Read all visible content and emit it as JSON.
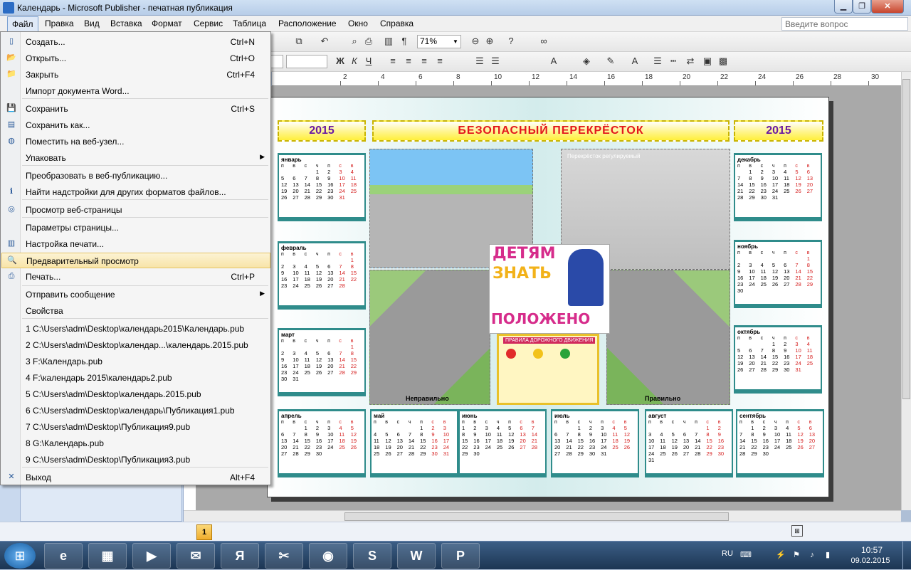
{
  "window": {
    "title": "Календарь - Microsoft Publisher - печатная публикация"
  },
  "menubar": {
    "items": [
      "Файл",
      "Правка",
      "Вид",
      "Вставка",
      "Формат",
      "Сервис",
      "Таблица",
      "Расположение",
      "Окно",
      "Справка"
    ],
    "ask_placeholder": "Введите вопрос"
  },
  "toolbar": {
    "zoom": "71%"
  },
  "ruler": {
    "marks": [
      "2",
      "4",
      "6",
      "8",
      "10",
      "12",
      "14",
      "16",
      "18",
      "20",
      "22",
      "24",
      "26",
      "28",
      "30"
    ]
  },
  "file_menu": {
    "items": [
      {
        "label": "Создать...",
        "shortcut": "Ctrl+N",
        "icon": "new-doc-icon"
      },
      {
        "label": "Открыть...",
        "shortcut": "Ctrl+O",
        "icon": "open-folder-icon"
      },
      {
        "label": "Закрыть",
        "shortcut": "Ctrl+F4",
        "icon": "close-folder-icon"
      },
      {
        "label": "Импорт документа Word...",
        "shortcut": "",
        "icon": ""
      },
      {
        "label": "Сохранить",
        "shortcut": "Ctrl+S",
        "icon": "save-icon"
      },
      {
        "label": "Сохранить как...",
        "shortcut": "",
        "icon": "save-as-icon"
      },
      {
        "label": "Поместить на веб-узел...",
        "shortcut": "",
        "icon": "web-publish-icon"
      },
      {
        "label": "Упаковать",
        "shortcut": "",
        "icon": ""
      },
      {
        "label": "Преобразовать в веб-публикацию...",
        "shortcut": "",
        "icon": ""
      },
      {
        "label": "Найти надстройки для других форматов файлов...",
        "shortcut": "",
        "icon": "info-icon"
      },
      {
        "label": "Просмотр веб-страницы",
        "shortcut": "",
        "icon": "web-preview-icon"
      },
      {
        "label": "Параметры страницы...",
        "shortcut": "",
        "icon": ""
      },
      {
        "label": "Настройка печати...",
        "shortcut": "",
        "icon": "print-setup-icon"
      },
      {
        "label": "Предварительный просмотр",
        "shortcut": "",
        "icon": "print-preview-icon"
      },
      {
        "label": "Печать...",
        "shortcut": "Ctrl+P",
        "icon": "printer-icon"
      },
      {
        "label": "Отправить сообщение",
        "shortcut": "",
        "icon": ""
      },
      {
        "label": "Свойства",
        "shortcut": "",
        "icon": ""
      },
      {
        "label": "1 C:\\Users\\adm\\Desktop\\календарь2015\\Календарь.pub",
        "shortcut": "",
        "icon": ""
      },
      {
        "label": "2 C:\\Users\\adm\\Desktop\\календар...\\календарь.2015.pub",
        "shortcut": "",
        "icon": ""
      },
      {
        "label": "3 F:\\Календарь.pub",
        "shortcut": "",
        "icon": ""
      },
      {
        "label": "4 F:\\календарь 2015\\календарь2.pub",
        "shortcut": "",
        "icon": ""
      },
      {
        "label": "5 C:\\Users\\adm\\Desktop\\календарь.2015.pub",
        "shortcut": "",
        "icon": ""
      },
      {
        "label": "6 C:\\Users\\adm\\Desktop\\календарь\\Публикация1.pub",
        "shortcut": "",
        "icon": ""
      },
      {
        "label": "7 C:\\Users\\adm\\Desktop\\Публикация9.pub",
        "shortcut": "",
        "icon": ""
      },
      {
        "label": "8 G:\\Календарь.pub",
        "shortcut": "",
        "icon": ""
      },
      {
        "label": "9 C:\\Users\\adm\\Desktop\\Публикация3.pub",
        "shortcut": "",
        "icon": ""
      },
      {
        "label": "Выход",
        "shortcut": "Alt+F4",
        "icon": "exit-icon"
      }
    ]
  },
  "calendar": {
    "year": "2015",
    "headline": "БЕЗОПАСНЫЙ ПЕРЕКРЁСТОК",
    "weekdays": [
      "п",
      "в",
      "с",
      "ч",
      "п",
      "с",
      "в"
    ],
    "caption_wrong": "Неправильно",
    "caption_right": "Правильно",
    "poster_line1": "ДЕТЯМ",
    "poster_line2": "ЗНАТЬ",
    "poster_line3": "ПОЛОЖЕНО",
    "rules_title": "ПРАВИЛА ДОРОЖНОГО ДВИЖЕНИЯ",
    "photo_caption": "Перекрёсток регулируемый",
    "months": {
      "jan": {
        "name": "январь",
        "days": [
          "",
          "",
          "",
          "1",
          "2",
          "3",
          "4",
          "5",
          "6",
          "7",
          "8",
          "9",
          "10",
          "11",
          "12",
          "13",
          "14",
          "15",
          "16",
          "17",
          "18",
          "19",
          "20",
          "21",
          "22",
          "23",
          "24",
          "25",
          "26",
          "27",
          "28",
          "29",
          "30",
          "31"
        ]
      },
      "feb": {
        "name": "февраль",
        "days": [
          "",
          "",
          "",
          "",
          "",
          "",
          "1",
          "2",
          "3",
          "4",
          "5",
          "6",
          "7",
          "8",
          "9",
          "10",
          "11",
          "12",
          "13",
          "14",
          "15",
          "16",
          "17",
          "18",
          "19",
          "20",
          "21",
          "22",
          "23",
          "24",
          "25",
          "26",
          "27",
          "28"
        ]
      },
      "mar": {
        "name": "март",
        "days": [
          "",
          "",
          "",
          "",
          "",
          "",
          "1",
          "2",
          "3",
          "4",
          "5",
          "6",
          "7",
          "8",
          "9",
          "10",
          "11",
          "12",
          "13",
          "14",
          "15",
          "16",
          "17",
          "18",
          "19",
          "20",
          "21",
          "22",
          "23",
          "24",
          "25",
          "26",
          "27",
          "28",
          "29",
          "30",
          "31"
        ]
      },
      "apr": {
        "name": "апрель",
        "days": [
          "",
          "",
          "1",
          "2",
          "3",
          "4",
          "5",
          "6",
          "7",
          "8",
          "9",
          "10",
          "11",
          "12",
          "13",
          "14",
          "15",
          "16",
          "17",
          "18",
          "19",
          "20",
          "21",
          "22",
          "23",
          "24",
          "25",
          "26",
          "27",
          "28",
          "29",
          "30"
        ]
      },
      "may": {
        "name": "май",
        "days": [
          "",
          "",
          "",
          "",
          "1",
          "2",
          "3",
          "4",
          "5",
          "6",
          "7",
          "8",
          "9",
          "10",
          "11",
          "12",
          "13",
          "14",
          "15",
          "16",
          "17",
          "18",
          "19",
          "20",
          "21",
          "22",
          "23",
          "24",
          "25",
          "26",
          "27",
          "28",
          "29",
          "30",
          "31"
        ]
      },
      "jun": {
        "name": "июнь",
        "days": [
          "1",
          "2",
          "3",
          "4",
          "5",
          "6",
          "7",
          "8",
          "9",
          "10",
          "11",
          "12",
          "13",
          "14",
          "15",
          "16",
          "17",
          "18",
          "19",
          "20",
          "21",
          "22",
          "23",
          "24",
          "25",
          "26",
          "27",
          "28",
          "29",
          "30"
        ]
      },
      "jul": {
        "name": "июль",
        "days": [
          "",
          "",
          "1",
          "2",
          "3",
          "4",
          "5",
          "6",
          "7",
          "8",
          "9",
          "10",
          "11",
          "12",
          "13",
          "14",
          "15",
          "16",
          "17",
          "18",
          "19",
          "20",
          "21",
          "22",
          "23",
          "24",
          "25",
          "26",
          "27",
          "28",
          "29",
          "30",
          "31"
        ]
      },
      "aug": {
        "name": "август",
        "days": [
          "",
          "",
          "",
          "",
          "",
          "1",
          "2",
          "3",
          "4",
          "5",
          "6",
          "7",
          "8",
          "9",
          "10",
          "11",
          "12",
          "13",
          "14",
          "15",
          "16",
          "17",
          "18",
          "19",
          "20",
          "21",
          "22",
          "23",
          "24",
          "25",
          "26",
          "27",
          "28",
          "29",
          "30",
          "31"
        ]
      },
      "sep": {
        "name": "сентябрь",
        "days": [
          "",
          "1",
          "2",
          "3",
          "4",
          "5",
          "6",
          "7",
          "8",
          "9",
          "10",
          "11",
          "12",
          "13",
          "14",
          "15",
          "16",
          "17",
          "18",
          "19",
          "20",
          "21",
          "22",
          "23",
          "24",
          "25",
          "26",
          "27",
          "28",
          "29",
          "30"
        ]
      },
      "oct": {
        "name": "октябрь",
        "days": [
          "",
          "",
          "",
          "1",
          "2",
          "3",
          "4",
          "5",
          "6",
          "7",
          "8",
          "9",
          "10",
          "11",
          "12",
          "13",
          "14",
          "15",
          "16",
          "17",
          "18",
          "19",
          "20",
          "21",
          "22",
          "23",
          "24",
          "25",
          "26",
          "27",
          "28",
          "29",
          "30",
          "31"
        ]
      },
      "nov": {
        "name": "ноябрь",
        "days": [
          "",
          "",
          "",
          "",
          "",
          "",
          "1",
          "2",
          "3",
          "4",
          "5",
          "6",
          "7",
          "8",
          "9",
          "10",
          "11",
          "12",
          "13",
          "14",
          "15",
          "16",
          "17",
          "18",
          "19",
          "20",
          "21",
          "22",
          "23",
          "24",
          "25",
          "26",
          "27",
          "28",
          "29",
          "30"
        ]
      },
      "dec": {
        "name": "декабрь",
        "days": [
          "",
          "1",
          "2",
          "3",
          "4",
          "5",
          "6",
          "7",
          "8",
          "9",
          "10",
          "11",
          "12",
          "13",
          "14",
          "15",
          "16",
          "17",
          "18",
          "19",
          "20",
          "21",
          "22",
          "23",
          "24",
          "25",
          "26",
          "27",
          "28",
          "29",
          "30",
          "31"
        ]
      }
    }
  },
  "status": {
    "page": "1"
  },
  "tray": {
    "lang": "RU",
    "time": "10:57",
    "date": "09.02.2015"
  },
  "taskbar": {
    "apps": [
      "internet-explorer-icon",
      "file-explorer-icon",
      "media-player-icon",
      "mail-icon",
      "yandex-icon",
      "tools-icon",
      "chrome-icon",
      "skype-icon",
      "word-icon",
      "publisher-icon"
    ]
  }
}
